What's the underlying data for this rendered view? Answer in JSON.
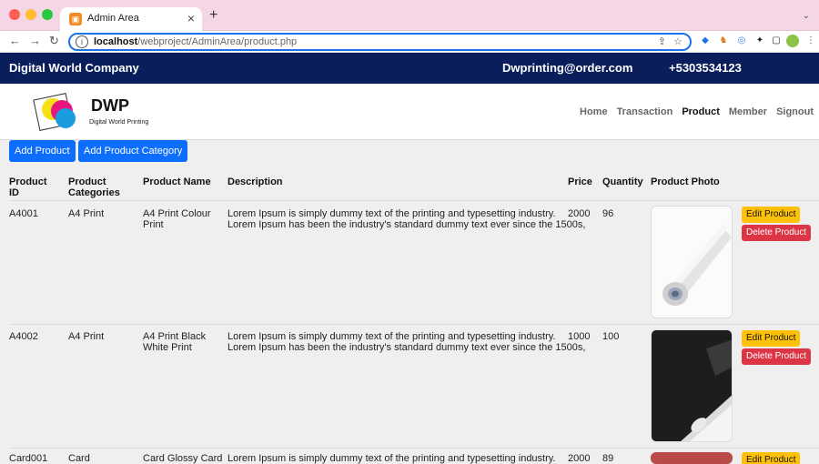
{
  "browser": {
    "tab_title": "Admin Area",
    "tab_close": "×",
    "new_tab": "+",
    "url_host": "localhost",
    "url_path": "/webproject/AdminArea/product.php"
  },
  "header": {
    "company": "Digital World Company",
    "email": "Dwprinting@order.com",
    "phone": "+5303534123"
  },
  "logo": {
    "title": "DWP",
    "subtitle": "Digital World Printing"
  },
  "nav": {
    "items": [
      {
        "label": "Home",
        "active": false
      },
      {
        "label": "Transaction",
        "active": false
      },
      {
        "label": "Product",
        "active": true
      },
      {
        "label": "Member",
        "active": false
      },
      {
        "label": "Signout",
        "active": false
      }
    ]
  },
  "actions": {
    "add_product": "Add Product",
    "add_category": "Add Product Category"
  },
  "table": {
    "headers": {
      "id_1": "Product",
      "id_2": "ID",
      "cat_1": "Product",
      "cat_2": "Categories",
      "name": "Product Name",
      "description": "Description",
      "price": "Price",
      "quantity": "Quantity",
      "photo": "Product Photo"
    },
    "rows": [
      {
        "id": "A4001",
        "category": "A4 Print",
        "name_1": "A4 Print Colour",
        "name_2": "Print",
        "desc_1": "Lorem Ipsum is simply dummy text of the printing and typesetting industry.",
        "desc_2": "Lorem Ipsum has been the industry's standard dummy text ever since the 1500s,",
        "price": "2000",
        "quantity": "96",
        "edit": "Edit Product",
        "delete": "Delete Product"
      },
      {
        "id": "A4002",
        "category": "A4 Print",
        "name_1": "A4 Print Black",
        "name_2": "White Print",
        "desc_1": "Lorem Ipsum is simply dummy text of the printing and typesetting industry.",
        "desc_2": "Lorem Ipsum has been the industry's standard dummy text ever since the 1500s,",
        "price": "1000",
        "quantity": "100",
        "edit": "Edit Product",
        "delete": "Delete Product"
      },
      {
        "id": "Card001",
        "category": "Card",
        "name_1": "Card Glossy Card",
        "desc_1": "Lorem Ipsum is simply dummy text of the printing and typesetting industry.",
        "price": "2000",
        "quantity": "89",
        "edit": "Edit Product"
      }
    ]
  }
}
